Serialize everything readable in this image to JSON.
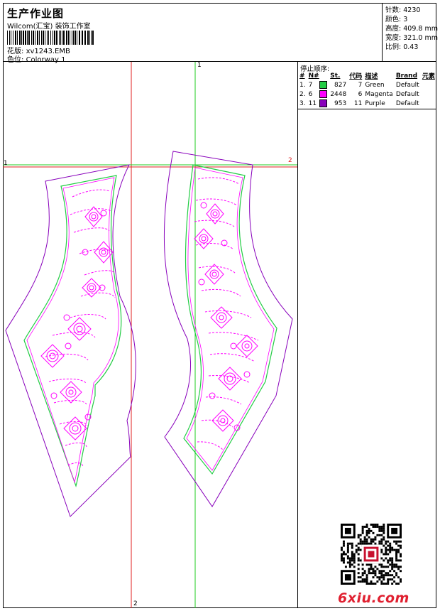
{
  "header": {
    "title": "生产作业图",
    "subtitle": "Wilcom(汇宝) 装饰工作室",
    "design_label": "花版:",
    "design_value": "xv1243.EMB",
    "colorway_label": "色位:",
    "colorway_value": "Colorway 1"
  },
  "stats": [
    {
      "label": "针数:",
      "value": "4230"
    },
    {
      "label": "颜色:",
      "value": "3"
    },
    {
      "label": "高度:",
      "value": "409.8 mm"
    },
    {
      "label": "宽度:",
      "value": "321.0 mm"
    },
    {
      "label": "比例:",
      "value": "0.43"
    }
  ],
  "stop_sequence": {
    "title": "停止顺序:",
    "headers": [
      "#",
      "N#",
      "St.",
      "代码",
      "描述",
      "Brand",
      "元素"
    ],
    "rows": [
      {
        "index": "1.",
        "needle": "7",
        "color": "#22cc44",
        "stitches": "827",
        "code": "7",
        "description": "Green",
        "brand": "Default"
      },
      {
        "index": "2.",
        "needle": "6",
        "color": "#ff00ff",
        "stitches": "2448",
        "code": "6",
        "description": "Magenta",
        "brand": "Default"
      },
      {
        "index": "3.",
        "needle": "11",
        "color": "#8800bb",
        "stitches": "953",
        "code": "11",
        "description": "Purple",
        "brand": "Default"
      }
    ]
  },
  "axis_markers": {
    "top": "1",
    "left": "1",
    "right": "2",
    "bottom": "2"
  },
  "watermark": "6xiu.com",
  "colors": {
    "green": "#22cc44",
    "magenta": "#ff00ff",
    "purple": "#8800bb",
    "guide_red": "#e02020",
    "guide_green": "#22cc22",
    "watermark": "#e02030"
  }
}
